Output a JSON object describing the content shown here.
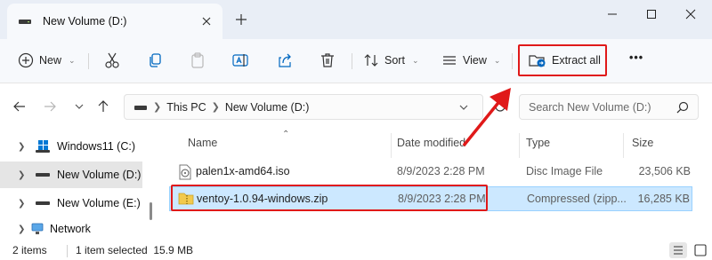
{
  "window": {
    "tab_title": "New Volume (D:)",
    "icons": [
      "drive-icon",
      "close-icon",
      "new-tab-icon",
      "minimize-icon",
      "maximize-icon",
      "close-window-icon"
    ]
  },
  "toolbar": {
    "new_label": "New",
    "sort_label": "Sort",
    "view_label": "View",
    "extract_label": "Extract all",
    "more_label": "•••"
  },
  "address": {
    "crumbs": [
      "This PC",
      "New Volume (D:)"
    ],
    "search_placeholder": "Search New Volume (D:)"
  },
  "sidebar": {
    "items": [
      {
        "label": "Windows11 (C:)",
        "selected": false
      },
      {
        "label": "New Volume (D:)",
        "selected": true
      },
      {
        "label": "New Volume (E:)",
        "selected": false
      },
      {
        "label": "Network",
        "selected": false
      }
    ]
  },
  "columns": [
    "Name",
    "Date modified",
    "Type",
    "Size"
  ],
  "files": [
    {
      "name": "palen1x-amd64.iso",
      "date": "8/9/2023 2:28 PM",
      "type": "Disc Image File",
      "size": "23,506 KB",
      "selected": false
    },
    {
      "name": "ventoy-1.0.94-windows.zip",
      "date": "8/9/2023 2:28 PM",
      "type": "Compressed (zipp...",
      "size": "16,285 KB",
      "selected": true
    }
  ],
  "status": {
    "items_count": "2 items",
    "selection": "1 item selected  15.9 MB"
  },
  "colors": {
    "highlight_red": "#e01919",
    "selection_blue": "#cce8ff",
    "accent_blue": "#0067c0"
  }
}
